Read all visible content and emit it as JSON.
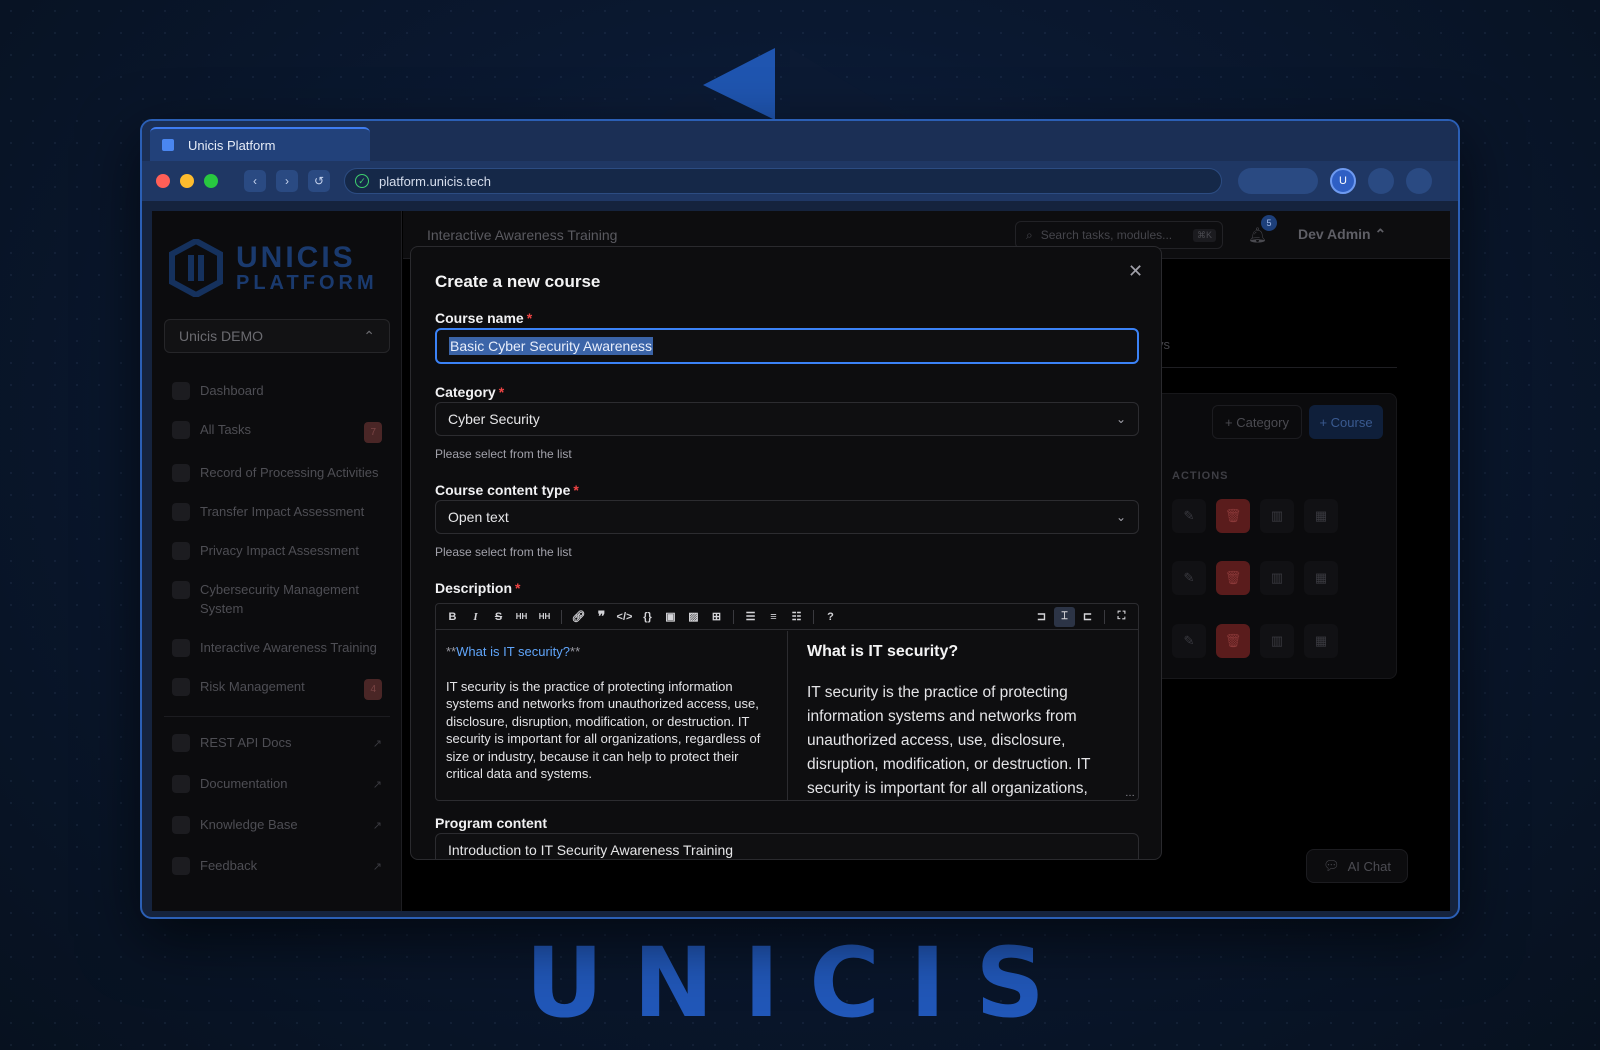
{
  "browser": {
    "tab_title": "Unicis Platform",
    "url": "platform.unicis.tech",
    "avatar_initial": "U"
  },
  "brand": {
    "wordmark": "UNICIS"
  },
  "sidebar": {
    "logo_line1": "UNICIS",
    "logo_line2": "PLATFORM",
    "org": "Unicis DEMO",
    "items": [
      {
        "label": "Dashboard"
      },
      {
        "label": "All Tasks",
        "badge": "7"
      },
      {
        "label": "Record of Processing Activities"
      },
      {
        "label": "Transfer Impact Assessment"
      },
      {
        "label": "Privacy Impact Assessment"
      },
      {
        "label": "Cybersecurity Management System"
      },
      {
        "label": "Interactive Awareness Training"
      },
      {
        "label": "Risk Management",
        "badge": "4"
      }
    ],
    "links": [
      {
        "label": "REST API Docs"
      },
      {
        "label": "Documentation"
      },
      {
        "label": "Knowledge Base"
      },
      {
        "label": "Feedback"
      }
    ]
  },
  "header": {
    "title": "Interactive Awareness Training",
    "search_placeholder": "Search tasks, modules...",
    "search_shortcut": "⌘K",
    "notif_count": "5",
    "user": "Dev Admin"
  },
  "background_page": {
    "tab_fragment": "ys",
    "add_category": "+ Category",
    "add_course": "+ Course",
    "actions_header": "ACTIONS",
    "ai_chat": "AI Chat"
  },
  "modal": {
    "title": "Create a new course",
    "course_name_label": "Course name",
    "course_name_value": "Basic Cyber Security Awareness",
    "category_label": "Category",
    "category_value": "Cyber Security",
    "category_help": "Please select from the list",
    "content_type_label": "Course content type",
    "content_type_value": "Open text",
    "content_type_help": "Please select from the list",
    "description_label": "Description",
    "description_md_heading": "What is IT security?",
    "description_md_marker": "**",
    "description_body": "IT security is the practice of protecting information systems and networks from unauthorized access, use, disclosure, disruption, modification, or destruction. IT security is important for all organizations, regardless of size or industry, because it can help to protect their critical data and systems.",
    "preview_heading": "What is IT security?",
    "preview_body": "IT security is the practice of protecting information systems and networks from unauthorized access, use, disclosure, disruption, modification, or destruction. IT security is important for all organizations,",
    "program_label": "Program content",
    "program_value": "Introduction to IT Security Awareness Training"
  },
  "colors": {
    "accent": "#3b82f6",
    "brand_blue": "#2157b8",
    "required": "#ef4444",
    "danger": "#5a1c1c"
  }
}
